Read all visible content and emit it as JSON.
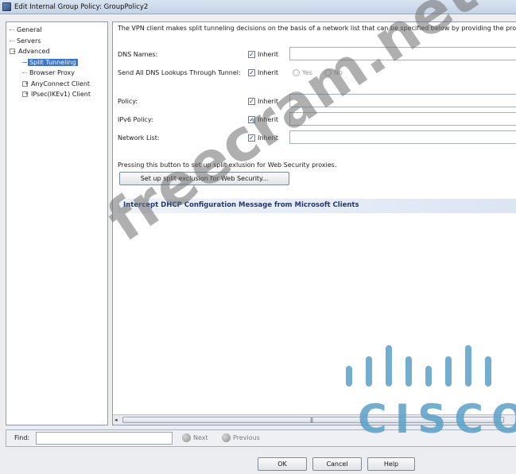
{
  "window": {
    "title": "Edit Internal Group Policy: GroupPolicy2"
  },
  "tree": {
    "items": [
      {
        "label": "General",
        "depth": 0,
        "expander": ""
      },
      {
        "label": "Servers",
        "depth": 0,
        "expander": ""
      },
      {
        "label": "Advanced",
        "depth": 0,
        "expander": "−"
      },
      {
        "label": "Split Tunneling",
        "depth": 1,
        "expander": "",
        "selected": true
      },
      {
        "label": "Browser Proxy",
        "depth": 1,
        "expander": ""
      },
      {
        "label": "AnyConnect Client",
        "depth": 1,
        "expander": "+"
      },
      {
        "label": "IPsec(IKEv1) Client",
        "depth": 1,
        "expander": "+"
      }
    ]
  },
  "content": {
    "description": "The VPN client makes split tunneling decisions on the basis of a network list that can be specified below by providing the prop",
    "dns_names_label": "DNS Names:",
    "send_all_dns_label": "Send All DNS Lookups Through Tunnel:",
    "policy_label": "Policy:",
    "ipv6_policy_label": "IPv6 Policy:",
    "network_list_label": "Network List:",
    "inherit_label": "Inherit",
    "check_mark": "✓",
    "yes_label": "Yes",
    "no_label": "No",
    "note": "Pressing this button to set up split exlusion for Web Security proxies.",
    "setup_button": "Set up split exclusion for Web Security...",
    "section_title": "Intercept DHCP Configuration Message from Microsoft Clients",
    "scroll_left_arrow": "◂",
    "scroll_grip": "|||"
  },
  "find": {
    "label": "Find:",
    "value": "",
    "next": "Next",
    "previous": "Previous"
  },
  "buttons": {
    "ok": "OK",
    "cancel": "Cancel",
    "help": "Help"
  },
  "watermark": "freecram.net",
  "logo": {
    "word": "CISCO",
    "color": "#58a0c8"
  }
}
